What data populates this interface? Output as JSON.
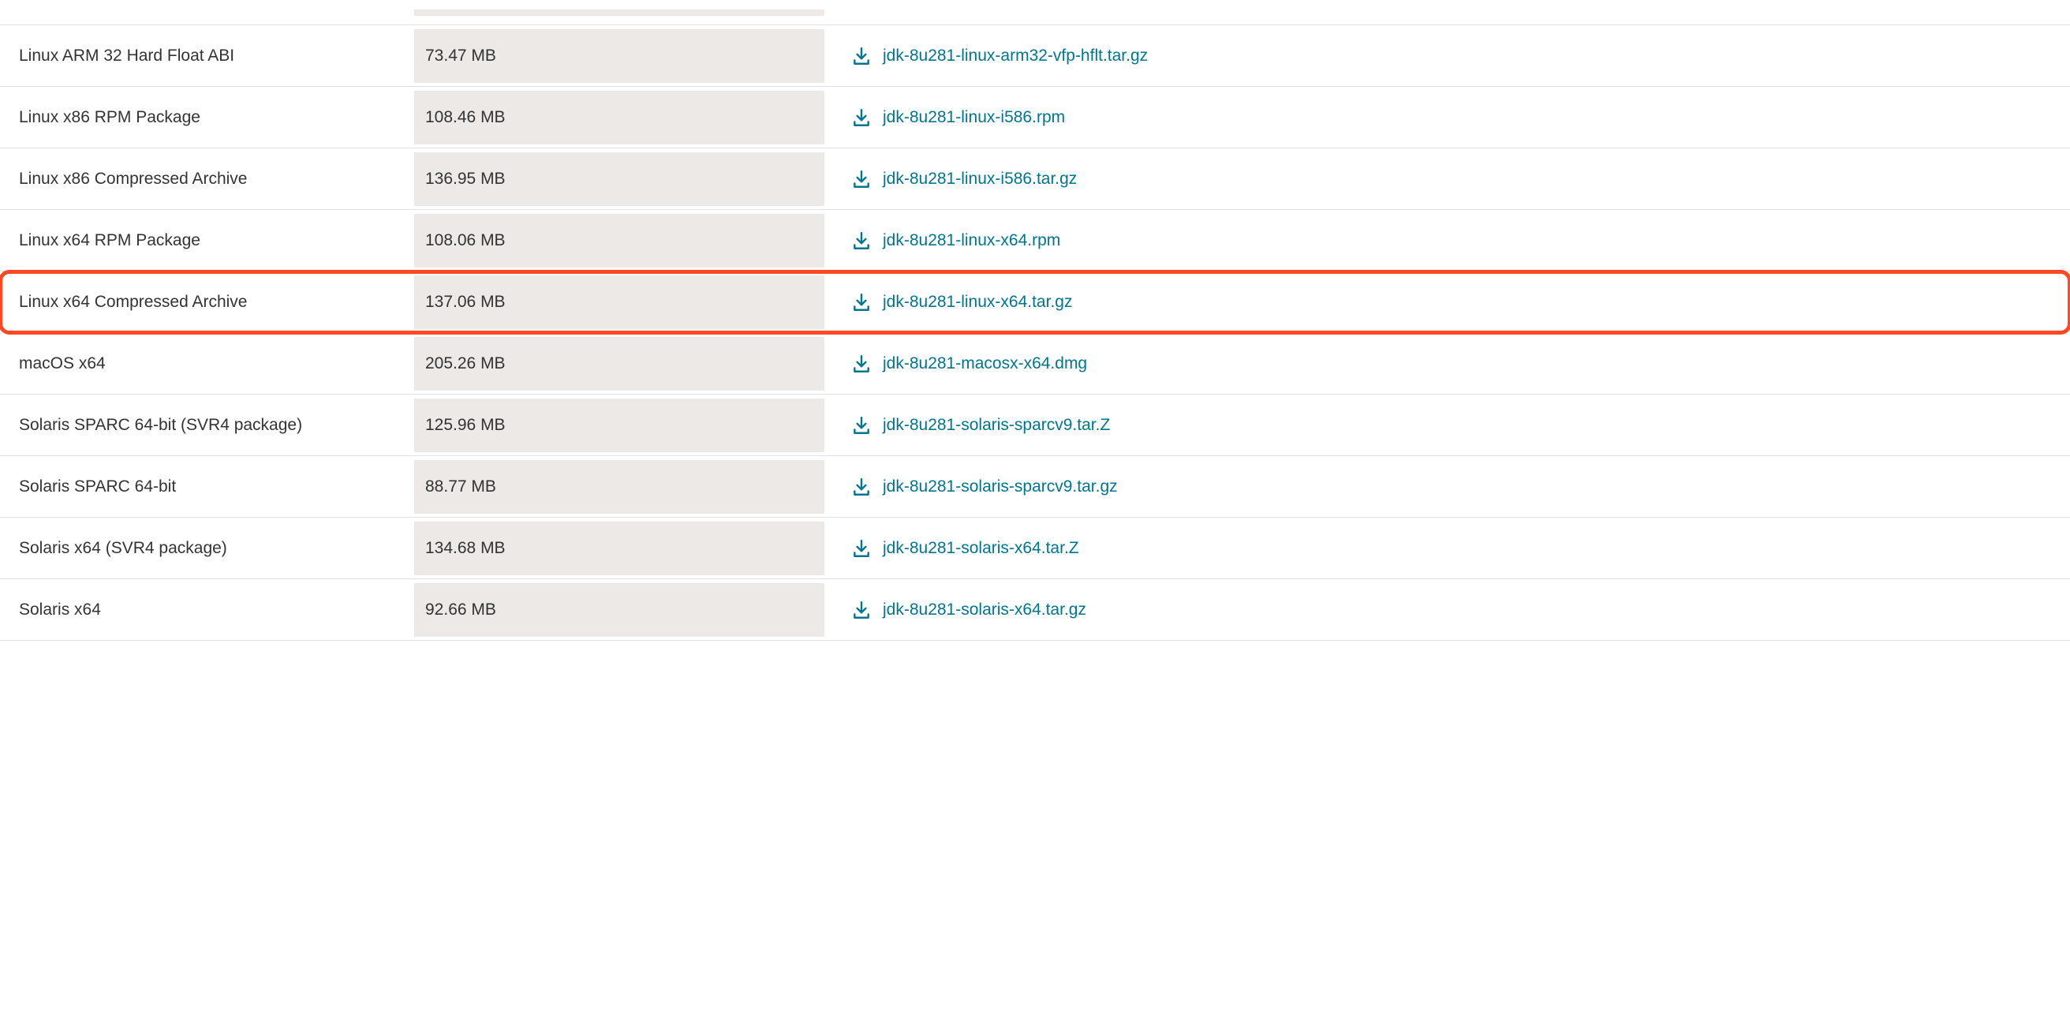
{
  "link_color": "#00758f",
  "highlight_color": "#ff4824",
  "rows": [
    {
      "product": "",
      "size": "",
      "filename": "",
      "partial": true,
      "highlighted": false
    },
    {
      "product": "Linux ARM 32 Hard Float ABI",
      "size": "73.47 MB",
      "filename": "jdk-8u281-linux-arm32-vfp-hflt.tar.gz",
      "highlighted": false
    },
    {
      "product": "Linux x86 RPM Package",
      "size": "108.46 MB",
      "filename": "jdk-8u281-linux-i586.rpm",
      "highlighted": false
    },
    {
      "product": "Linux x86 Compressed Archive",
      "size": "136.95 MB",
      "filename": "jdk-8u281-linux-i586.tar.gz",
      "highlighted": false
    },
    {
      "product": "Linux x64 RPM Package",
      "size": "108.06 MB",
      "filename": "jdk-8u281-linux-x64.rpm",
      "highlighted": false
    },
    {
      "product": "Linux x64 Compressed Archive",
      "size": "137.06 MB",
      "filename": "jdk-8u281-linux-x64.tar.gz",
      "highlighted": true
    },
    {
      "product": "macOS x64",
      "size": "205.26 MB",
      "filename": "jdk-8u281-macosx-x64.dmg",
      "highlighted": false
    },
    {
      "product": "Solaris SPARC 64-bit (SVR4 package)",
      "size": "125.96 MB",
      "filename": "jdk-8u281-solaris-sparcv9.tar.Z",
      "highlighted": false
    },
    {
      "product": "Solaris SPARC 64-bit",
      "size": "88.77 MB",
      "filename": "jdk-8u281-solaris-sparcv9.tar.gz",
      "highlighted": false
    },
    {
      "product": "Solaris x64 (SVR4 package)",
      "size": "134.68 MB",
      "filename": "jdk-8u281-solaris-x64.tar.Z",
      "highlighted": false
    },
    {
      "product": "Solaris x64",
      "size": "92.66 MB",
      "filename": "jdk-8u281-solaris-x64.tar.gz",
      "highlighted": false
    }
  ]
}
